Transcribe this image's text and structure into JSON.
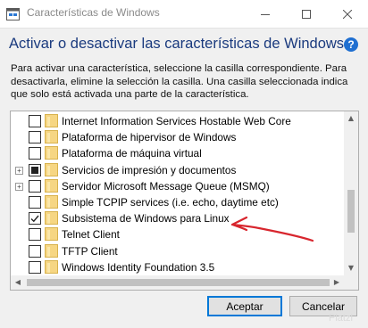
{
  "window": {
    "title": "Características de Windows",
    "minimize_glyph": "—",
    "maximize_glyph": "☐",
    "close_glyph": "✕"
  },
  "dialog": {
    "heading": "Activar o desactivar las características de Windows",
    "help_glyph": "?",
    "description_lines": [
      "Para activar una característica, seleccione la casilla correspondiente. Para",
      "desactivarla, elimine la selección la casilla. Una casilla seleccionada indica",
      "que solo está activada una parte de la característica."
    ]
  },
  "features": [
    {
      "label": "Internet Information Services Hostable Web Core",
      "state": "unchecked",
      "expandable": false
    },
    {
      "label": "Plataforma de hipervisor de Windows",
      "state": "unchecked",
      "expandable": false
    },
    {
      "label": "Plataforma de máquina virtual",
      "state": "unchecked",
      "expandable": false
    },
    {
      "label": "Servicios de impresión y documentos",
      "state": "partial",
      "expandable": true
    },
    {
      "label": "Servidor Microsoft Message Queue (MSMQ)",
      "state": "unchecked",
      "expandable": true
    },
    {
      "label": "Simple TCPIP services (i.e. echo, daytime etc)",
      "state": "unchecked",
      "expandable": false
    },
    {
      "label": "Subsistema de Windows para Linux",
      "state": "checked",
      "expandable": false
    },
    {
      "label": "Telnet Client",
      "state": "unchecked",
      "expandable": false
    },
    {
      "label": "TFTP Client",
      "state": "unchecked",
      "expandable": false
    },
    {
      "label": "Windows Identity Foundation 3.5",
      "state": "unchecked",
      "expandable": false
    }
  ],
  "buttons": {
    "accept": "Aceptar",
    "cancel": "Cancelar"
  },
  "watermark": "Platzi",
  "colors": {
    "heading": "#1a3a7e",
    "help": "#1f6fd1",
    "accept_border": "#0078d7",
    "annotation": "#d8262e",
    "folder": "#f6d683"
  },
  "icons": {
    "expander": "plus-box-icon",
    "folder": "folder-icon",
    "window": "windows-features-icon",
    "help": "help-icon"
  }
}
